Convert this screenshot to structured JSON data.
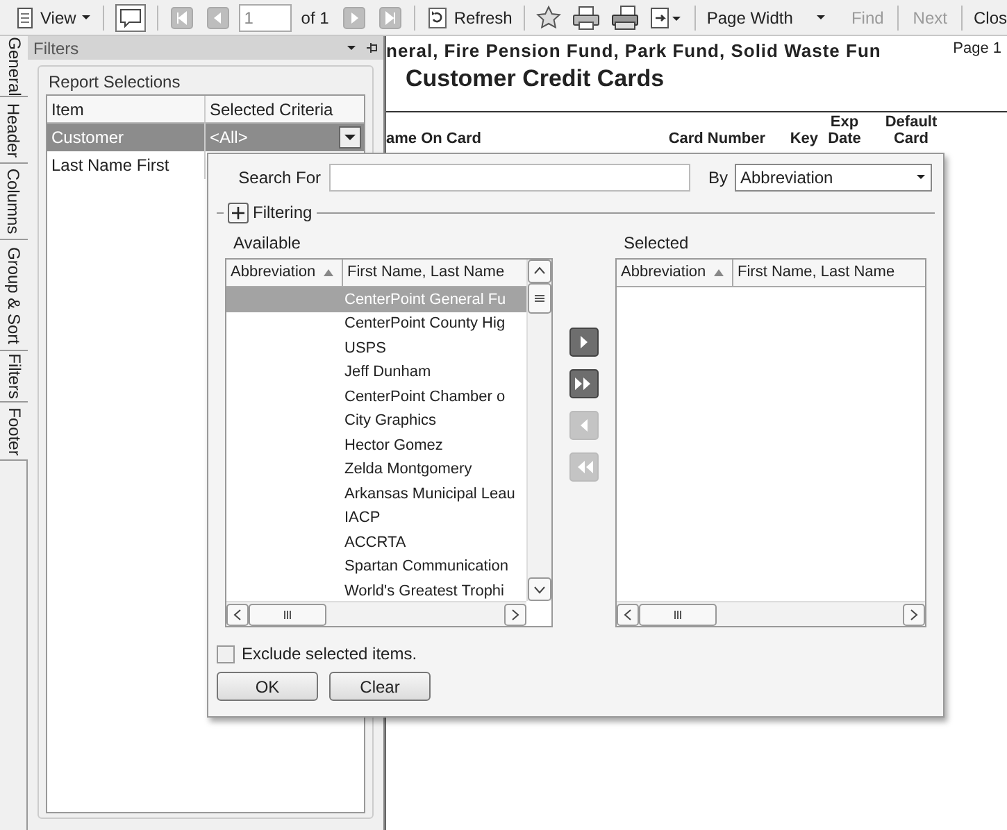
{
  "toolbar": [
    [
      {
        "kind": "menu",
        "label": "View"
      }
    ],
    [
      {
        "kind": "comment"
      }
    ],
    [
      {
        "kind": "first",
        "disabled": true
      },
      {
        "kind": "prev",
        "disabled": true
      },
      {
        "kind": "page",
        "value": "1"
      },
      {
        "kind": "text",
        "label": "of 1"
      },
      {
        "kind": "next",
        "disabled": true
      },
      {
        "kind": "last",
        "disabled": true
      }
    ],
    [
      {
        "kind": "refresh",
        "label": "Refresh"
      }
    ],
    [
      {
        "kind": "star"
      },
      {
        "kind": "printer"
      },
      {
        "kind": "printer2"
      },
      {
        "kind": "export"
      }
    ],
    [
      {
        "kind": "dropdown",
        "label": "Page Width"
      }
    ],
    [
      {
        "kind": "link",
        "label": "Find",
        "disabled": true
      }
    ],
    [
      {
        "kind": "link",
        "label": "Next",
        "disabled": true
      }
    ],
    [
      {
        "kind": "link",
        "label": "Clos",
        "disabled": false
      }
    ]
  ],
  "side_tabs": [
    {
      "label": "General"
    },
    {
      "label": "Header"
    },
    {
      "label": "Columns"
    },
    {
      "label": "Group & Sort"
    },
    {
      "label": "Filters"
    },
    {
      "label": "Footer"
    }
  ],
  "filters_panel": {
    "title": "Filters",
    "group_title": "Report Selections",
    "columns": [
      "Item",
      "Selected Criteria"
    ],
    "rows": [
      {
        "item": "Customer",
        "criteria": "<All>",
        "selected": true
      },
      {
        "item": "Last Name First",
        "selected": false
      }
    ]
  },
  "report": {
    "header_line": "neral, Fire Pension Fund, Park Fund, Solid Waste Fun",
    "page_label": "Page 1",
    "title": "Customer Credit Cards",
    "columns": [
      "ame On Card",
      "Card Number",
      "Key",
      "Exp Date",
      "Default Card"
    ]
  },
  "dialog": {
    "search_label": "Search For",
    "by_label": "By",
    "by_value": "Abbreviation",
    "filtering": {
      "label": "Filtering",
      "expanded": false
    },
    "available": {
      "label": "Available",
      "columns": [
        {
          "label": "Abbreviation",
          "sorted": true
        },
        {
          "label": "First Name, Last Name",
          "sorted": false
        }
      ],
      "rows": [
        {
          "name": "CenterPoint General Fu",
          "selected": true
        },
        {
          "name": "CenterPoint County Hig",
          "selected": false
        },
        {
          "name": "USPS",
          "selected": false
        },
        {
          "name": "Jeff Dunham",
          "selected": false
        },
        {
          "name": "CenterPoint Chamber o",
          "selected": false
        },
        {
          "name": "City Graphics",
          "selected": false
        },
        {
          "name": "Hector Gomez",
          "selected": false
        },
        {
          "name": "Zelda Montgomery",
          "selected": false
        },
        {
          "name": "Arkansas Municipal Leau",
          "selected": false
        },
        {
          "name": "IACP",
          "selected": false
        },
        {
          "name": "ACCRTA",
          "selected": false
        },
        {
          "name": "Spartan Communication",
          "selected": false
        },
        {
          "name": "World's Greatest Trophi",
          "selected": false
        }
      ]
    },
    "move_buttons": [
      {
        "kind": "add",
        "disabled": false
      },
      {
        "kind": "add_all",
        "disabled": false
      },
      {
        "kind": "remove",
        "disabled": true
      },
      {
        "kind": "remove_all",
        "disabled": true
      }
    ],
    "selected": {
      "label": "Selected",
      "columns": [
        {
          "label": "Abbreviation",
          "sorted": true
        },
        {
          "label": "First Name, Last Name",
          "sorted": false
        }
      ]
    },
    "exclude": {
      "label": "Exclude selected items.",
      "checked": false
    },
    "buttons": [
      "OK",
      "Clear"
    ]
  }
}
